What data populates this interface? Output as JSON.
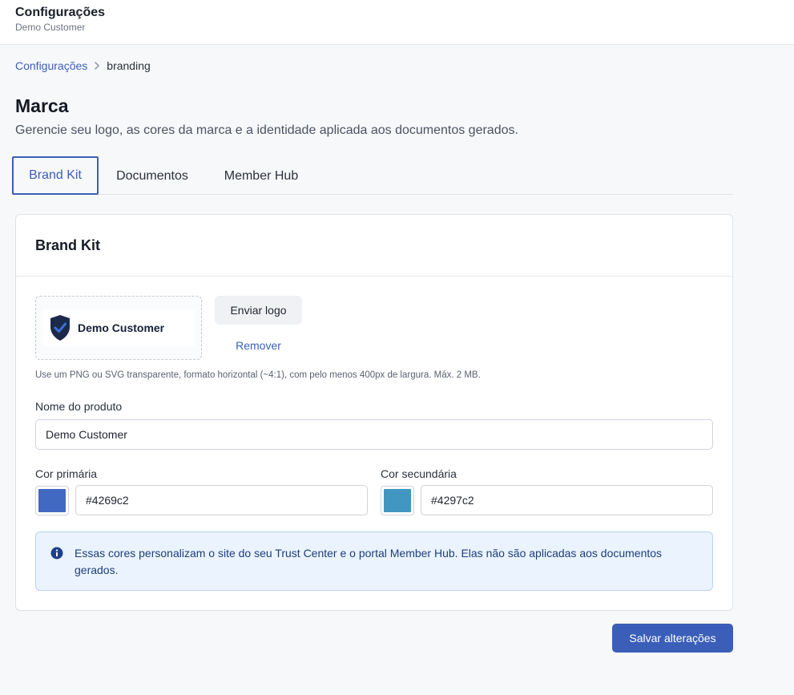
{
  "header": {
    "title": "Configurações",
    "subtitle": "Demo Customer"
  },
  "breadcrumb": {
    "parent": "Configurações",
    "current": "branding"
  },
  "page": {
    "title": "Marca",
    "description": "Gerencie seu logo, as cores da marca e a identidade aplicada aos documentos gerados."
  },
  "tabs": [
    {
      "label": "Brand Kit",
      "active": true
    },
    {
      "label": "Documentos",
      "active": false
    },
    {
      "label": "Member Hub",
      "active": false
    }
  ],
  "brand_kit": {
    "card_title": "Brand Kit",
    "logo_text": "Demo Customer",
    "upload_label": "Enviar logo",
    "remove_label": "Remover",
    "hint": "Use um PNG ou SVG transparente, formato horizontal (~4:1), com pelo menos 400px de largura. Máx. 2 MB.",
    "product_name_label": "Nome do produto",
    "product_name_value": "Demo Customer",
    "primary_color_label": "Cor primária",
    "primary_color_value": "#4269c2",
    "secondary_color_label": "Cor secundária",
    "secondary_color_value": "#4297c2",
    "info_text": "Essas cores personalizam o site do seu Trust Center e o portal Member Hub. Elas não são aplicadas aos documentos gerados."
  },
  "actions": {
    "save_label": "Salvar alterações"
  },
  "icons": {
    "breadcrumb_separator": "chevron-right-icon",
    "logo": "shield-check-icon",
    "info": "info-icon"
  },
  "colors": {
    "accent": "#3b5fb8",
    "logo_shield": "#1b2a4a",
    "logo_check": "#3b6fd8",
    "info_bg": "#eaf3fe"
  }
}
